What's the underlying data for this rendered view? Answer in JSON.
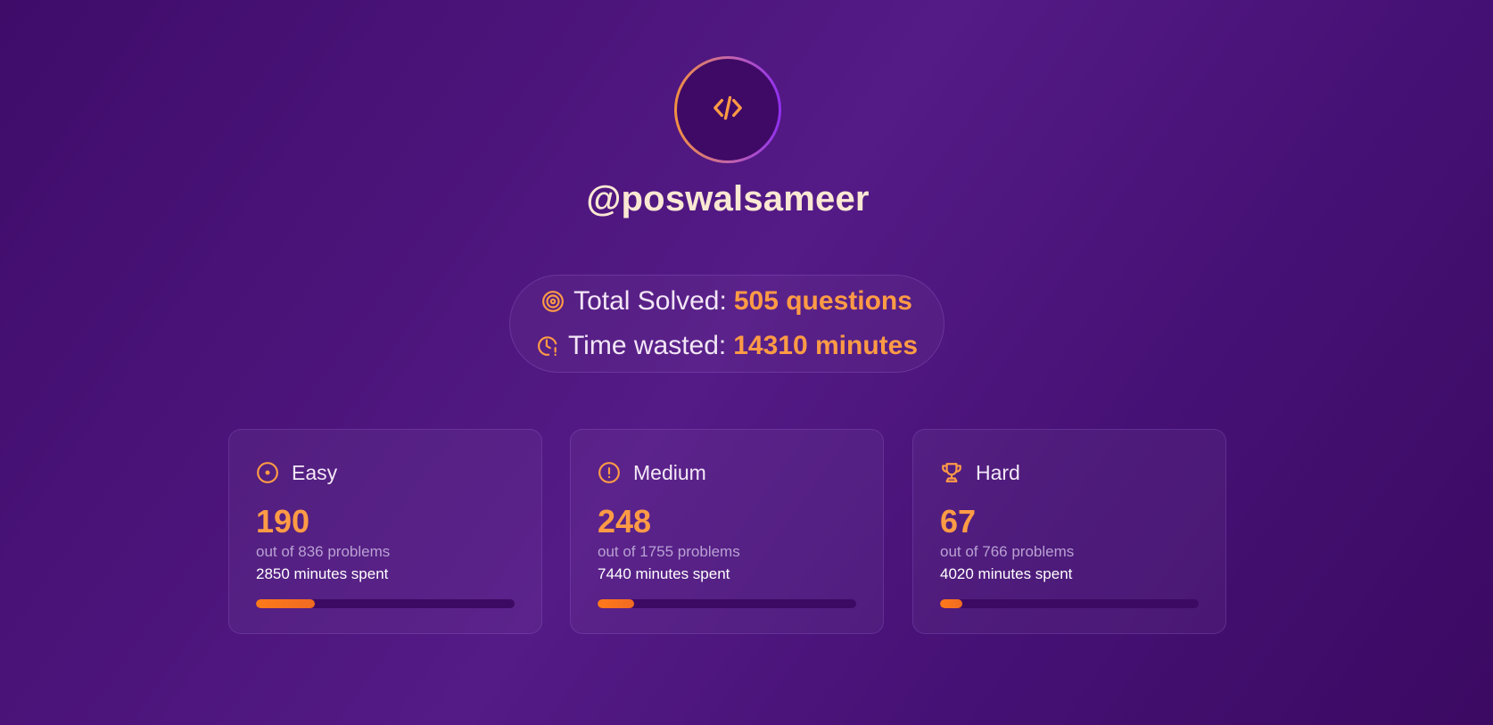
{
  "profile": {
    "username": "@poswalsameer",
    "avatar_icon": "code-icon"
  },
  "summary": {
    "total_solved_label": "Total Solved:",
    "total_solved_value": "505 questions",
    "time_wasted_label": "Time wasted:",
    "time_wasted_value": "14310 minutes",
    "total_solved_icon": "target-icon",
    "time_wasted_icon": "clock-alert-icon"
  },
  "cards": [
    {
      "title": "Easy",
      "icon": "circle-dot-icon",
      "count": "190",
      "out_of": "out of 836 problems",
      "minutes": "2850 minutes spent",
      "progress": 0.227
    },
    {
      "title": "Medium",
      "icon": "alert-circle-icon",
      "count": "248",
      "out_of": "out of 1755 problems",
      "minutes": "7440 minutes spent",
      "progress": 0.141
    },
    {
      "title": "Hard",
      "icon": "trophy-icon",
      "count": "67",
      "out_of": "out of 766 problems",
      "minutes": "4020 minutes spent",
      "progress": 0.087
    }
  ],
  "colors": {
    "accent": "#ff9b45",
    "bar_fill": "#ff7a1a",
    "bar_track": "#3d0a63",
    "username": "#fbe8d3",
    "background_start": "#3f0c6a",
    "background_mid": "#541a86"
  }
}
